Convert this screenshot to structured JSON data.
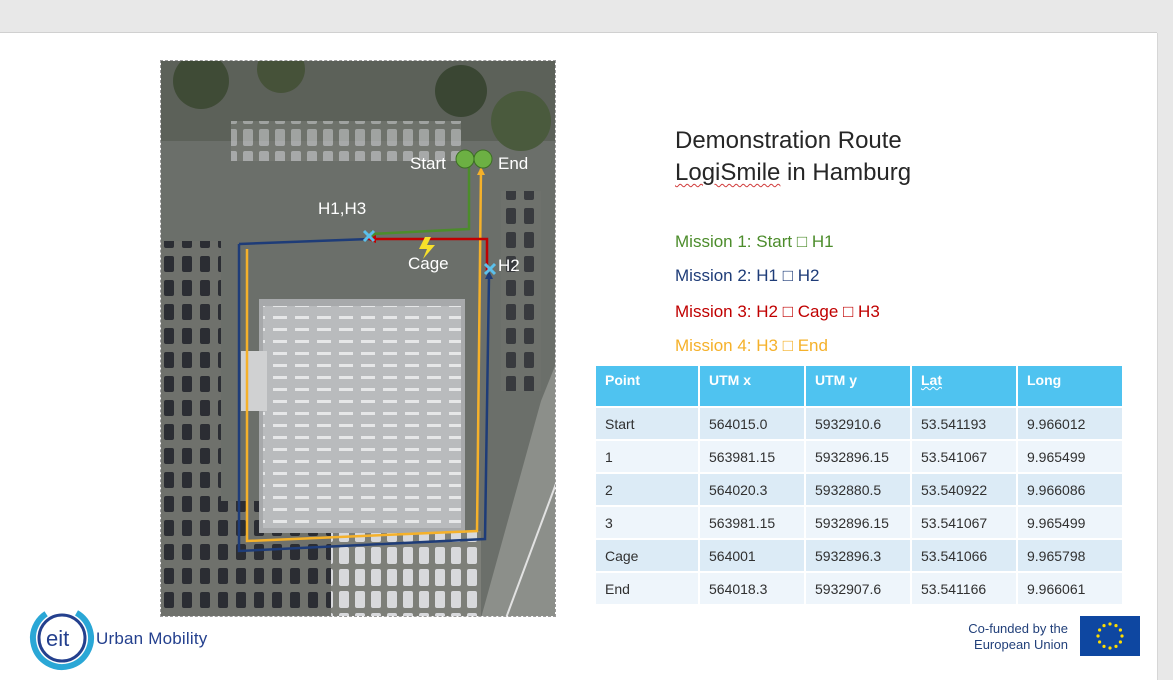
{
  "title": {
    "line1": "Demonstration Route",
    "line2_underlined": "LogiSmile",
    "line2_rest": " in Hamburg"
  },
  "missions": [
    {
      "label": "Mission 1: Start □ H1",
      "color": "#4c8c2b"
    },
    {
      "label": "Mission 2: H1 □ H2",
      "color": "#1e3c78"
    },
    {
      "label": "Mission 3: H2 □ Cage □ H3",
      "color": "#c00000"
    },
    {
      "label": "Mission 4: H3 □ End",
      "color": "#f5b12a"
    }
  ],
  "map_labels": {
    "start": "Start",
    "end": "End",
    "h1h3": "H1,H3",
    "cage": "Cage",
    "h2": "H2"
  },
  "table": {
    "headers": [
      "Point",
      "UTM x",
      "UTM y",
      "Lat",
      "Long"
    ],
    "rows": [
      [
        "Start",
        "564015.0",
        "5932910.6",
        "53.541193",
        "9.966012"
      ],
      [
        "1",
        "563981.15",
        "5932896.15",
        "53.541067",
        "9.965499"
      ],
      [
        "2",
        "564020.3",
        "5932880.5",
        "53.540922",
        "9.966086"
      ],
      [
        "3",
        "563981.15",
        "5932896.15",
        "53.541067",
        "9.965499"
      ],
      [
        "Cage",
        "564001",
        "5932896.3",
        "53.541066",
        "9.965798"
      ],
      [
        "End",
        "564018.3",
        "5932907.6",
        "53.541166",
        "9.966061"
      ]
    ]
  },
  "logo": {
    "text": "Urban Mobility",
    "mark": "eit"
  },
  "eu": {
    "line1": "Co-funded by the",
    "line2": "European Union"
  },
  "colors": {
    "header": "#4fc3f0",
    "row_dark": "#dcebf6",
    "row_light": "#eef5fb",
    "route_green": "#4c8c2b",
    "route_blue": "#1e3c78",
    "route_red": "#c00000",
    "route_orange": "#f5b12a",
    "waypoint": "#5bc0eb"
  }
}
